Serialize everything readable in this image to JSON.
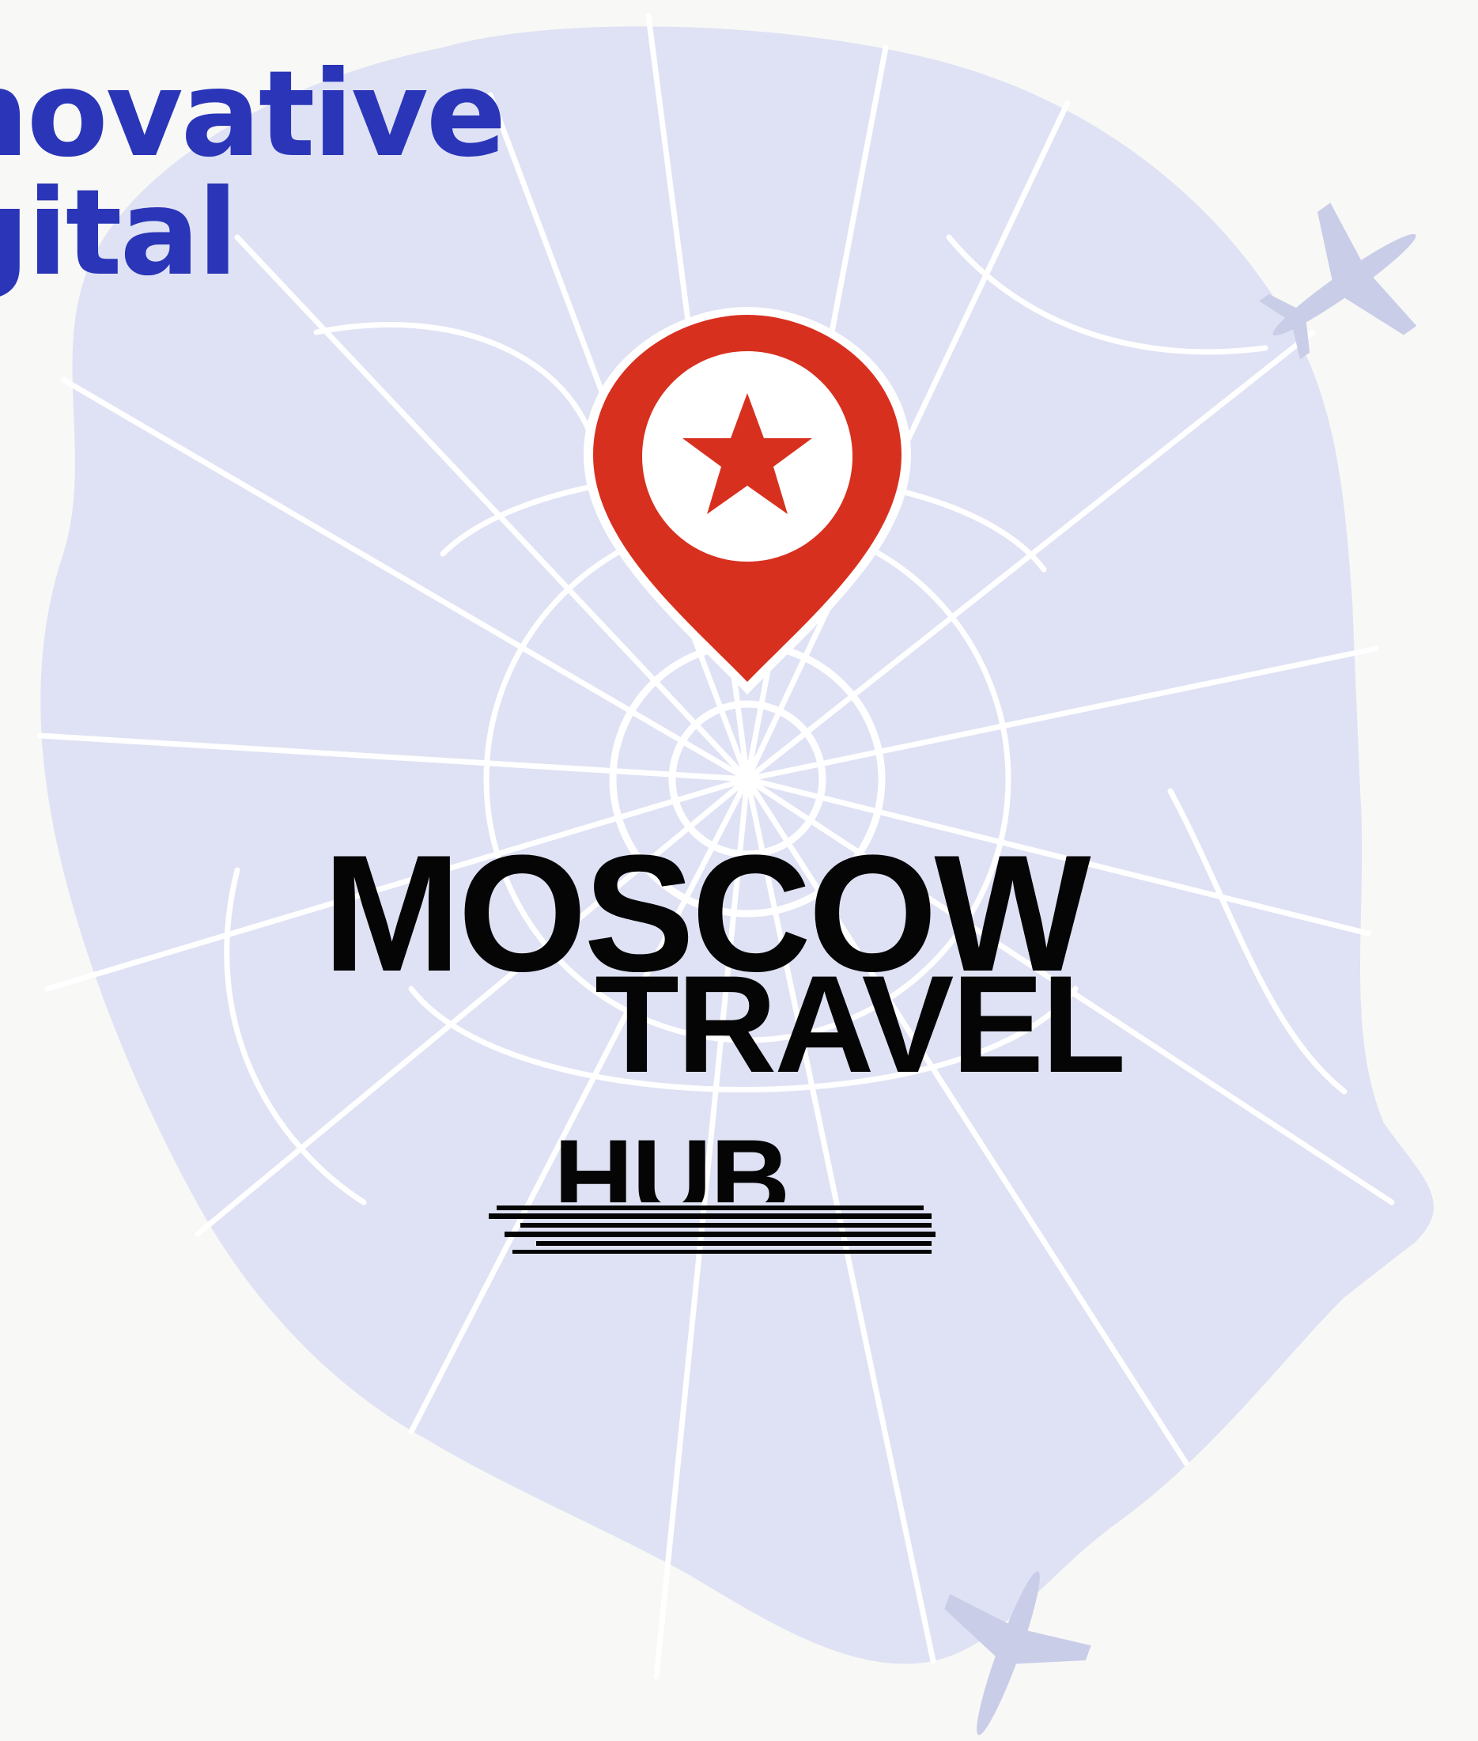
{
  "headline": {
    "line1": "novative",
    "line2": "gital",
    "color": "#2a35b8"
  },
  "logo": {
    "line1": "MOSCOW",
    "line2": "TRAVEL",
    "line3": "HUB",
    "color": "#050505"
  },
  "map": {
    "fill_color": "#dfe2f4",
    "road_color": "#ffffff",
    "pin_color": "#d8301f",
    "star_color": "#d8301f"
  },
  "icons": [
    "airplane-icon",
    "location-pin-icon",
    "star-icon"
  ]
}
